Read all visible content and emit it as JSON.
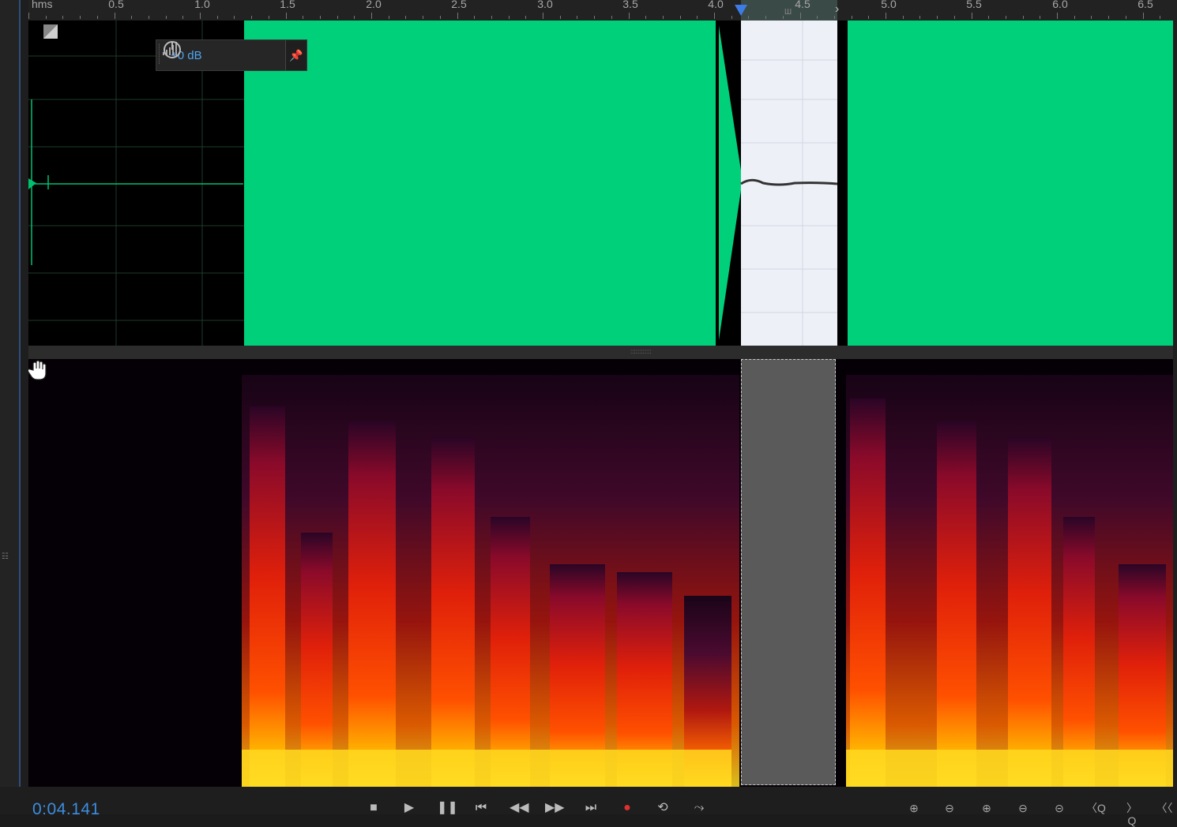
{
  "ruler": {
    "unit_label": "hms",
    "labels": [
      "0.5",
      "1.0",
      "1.5",
      "2.0",
      "2.5",
      "3.0",
      "3.5",
      "4.0",
      "4.5",
      "5.0",
      "5.5",
      "6.0",
      "6.5"
    ]
  },
  "hud": {
    "gain_value": "+0 dB",
    "pin_icon": "pin-icon"
  },
  "transport": {
    "timecode": "0:04.141"
  },
  "colors": {
    "waveform": "#00d07a",
    "selection_wave": "#eef0f8",
    "accent": "#3c8ee0",
    "record": "#e03030"
  },
  "icons": {
    "stop": "stop-icon",
    "play": "play-icon",
    "pause": "pause-icon",
    "prev": "skip-back-icon",
    "rewind": "rewind-icon",
    "forward": "fast-forward-icon",
    "next": "skip-forward-icon",
    "record": "record-icon",
    "loop": "loop-icon",
    "skip-selection": "skip-selection-icon"
  }
}
